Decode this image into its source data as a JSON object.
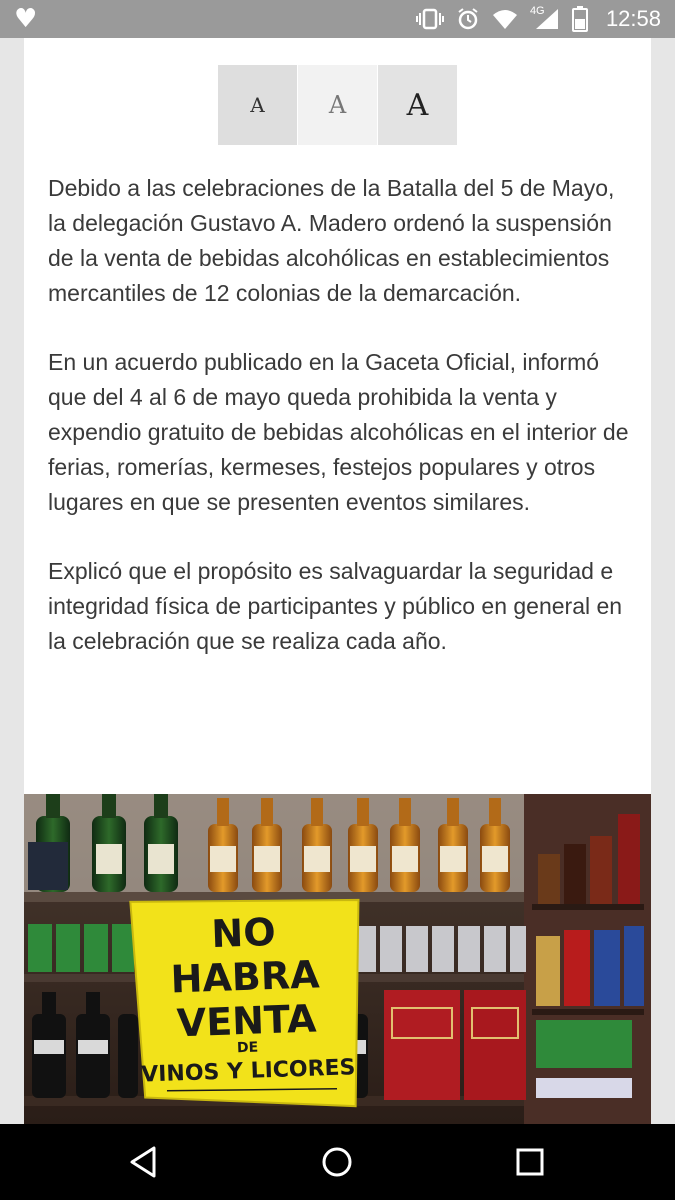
{
  "status_bar": {
    "time": "12:58",
    "network": "4G",
    "icons": [
      "heart-icon",
      "vibrate-icon",
      "alarm-icon",
      "wifi-icon",
      "signal-icon",
      "battery-icon"
    ]
  },
  "font_size_controls": {
    "small": "A",
    "medium": "A",
    "large": "A"
  },
  "article": {
    "paragraphs": [
      "Debido a las celebraciones de la Batalla del 5 de Mayo, la delegación Gustavo A. Madero ordenó la suspensión de la venta de bebidas alcohólicas en establecimientos mercantiles de 12 colonias de la demarcación.",
      "En un acuerdo publicado en la Gaceta Oficial, informó que del 4 al 6 de mayo queda prohibida la venta y expendio gratuito de bebidas alcohólicas en el interior de ferias, romerías, kermeses, festejos populares y otros lugares en que se presenten eventos similares.",
      "Explicó que el propósito es salvaguardar la seguridad e integridad física de participantes y público en general en la celebración que se realiza cada año."
    ]
  },
  "photo": {
    "sign_lines": [
      "NO",
      "HABRA",
      "VENTA",
      "DE",
      "VINOS Y LICORES"
    ]
  },
  "nav_bar": {
    "icons": [
      "back-icon",
      "home-icon",
      "recents-icon"
    ]
  }
}
